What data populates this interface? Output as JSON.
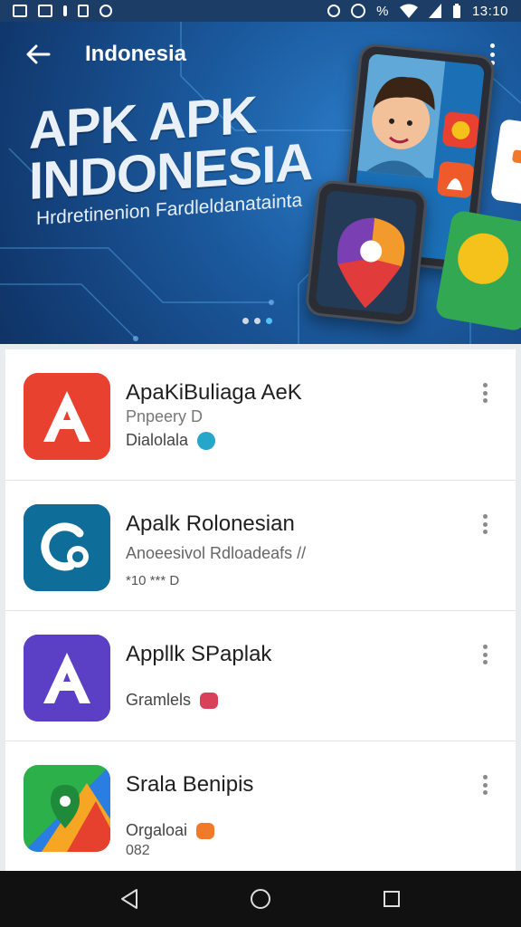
{
  "status_bar": {
    "time": "13:10",
    "battery_percent_text": "%",
    "left_icons": [
      "image-icon",
      "image-icon",
      "notification-dot-icon",
      "app-icon",
      "settings-icon"
    ],
    "right_icons": [
      "alarm-icon",
      "data-saver-icon",
      "wifi-icon",
      "signal-icon",
      "battery-icon"
    ]
  },
  "app_bar": {
    "title": "Indonesia",
    "back_icon": "arrow-left-icon",
    "menu_icon": "more-vert-icon"
  },
  "banner": {
    "headline_line1": "APK APK",
    "headline_line2": "INDONESIA",
    "subline": "Hrdretinenion Fardleldanatainta",
    "carousel_dots": 3,
    "active_dot": 2,
    "colors": {
      "dot_active": "#4fc3f7",
      "dot_inactive": "#cfd8e3"
    }
  },
  "apps": [
    {
      "title": "ApaKiBuliaga AeK",
      "line1": "Pnpeery D",
      "line2": "Dialolala",
      "line3": "",
      "icon": "letter-a-icon",
      "icon_color": "#e8412f",
      "badge_color": "#26a6c9"
    },
    {
      "title": "Apalk Rolonesian",
      "line1": "Anoeesivol Rdloadeafs  //",
      "line2": "",
      "line3": "*10 *** D",
      "icon": "circle-link-icon",
      "icon_color": "#0f6d9a",
      "badge_color": ""
    },
    {
      "title": "Appllk SPaplak",
      "line1": "",
      "line2": "Gramlels",
      "line3": "",
      "icon": "letter-a-icon",
      "icon_color": "#5b3fc4",
      "badge_color": "#d9415a"
    },
    {
      "title": "Srala Benipis",
      "line1": "",
      "line2": "Orgaloai",
      "line3": "082",
      "icon": "map-pin-icon",
      "icon_color": "#2bb04a",
      "badge_color": "#f07a2a"
    }
  ],
  "nav_bar": {
    "buttons": [
      "back-triangle-icon",
      "home-circle-icon",
      "recents-square-icon"
    ]
  }
}
